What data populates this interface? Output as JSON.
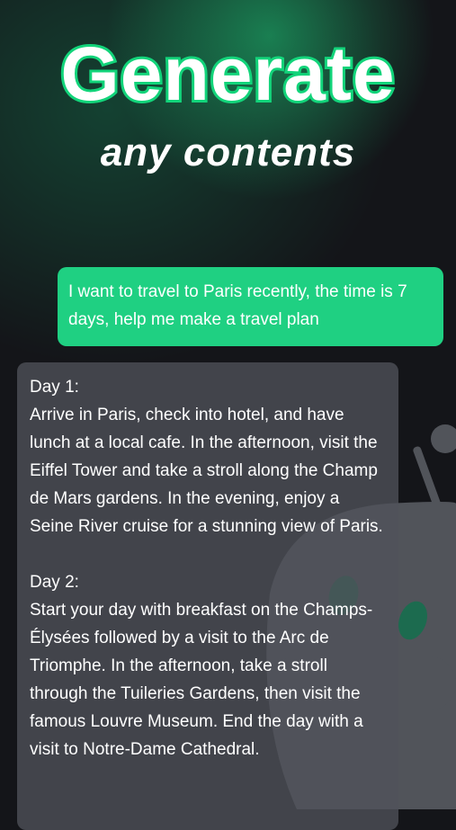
{
  "header": {
    "title": "Generate",
    "subtitle": "any contents"
  },
  "chat": {
    "user_message": "I want to travel to Paris recently, the time is 7 days, help me make a travel plan",
    "ai_response": {
      "days": [
        {
          "label": "Day 1:",
          "text": "Arrive in Paris, check into hotel, and have lunch at a local cafe. In the afternoon, visit the Eiffel Tower and take a stroll along the Champ de Mars gardens. In the evening, enjoy a Seine River cruise for a stunning view of Paris."
        },
        {
          "label": "Day 2:",
          "text": "Start your day with breakfast on the Champs-Élysées followed by a visit to the Arc de Triomphe. In the afternoon, take a stroll through the Tuileries Gardens, then visit the famous Louvre Museum. End the day with a visit to Notre-Dame Cathedral."
        }
      ]
    }
  },
  "colors": {
    "accent": "#1fd082",
    "background": "#141519",
    "bubble": "#50525a"
  },
  "icons": {
    "mascot": "robot-mascot-icon"
  }
}
